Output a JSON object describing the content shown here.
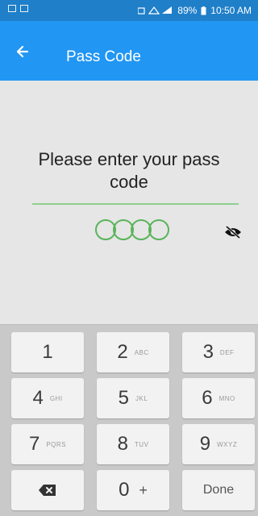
{
  "status_bar": {
    "battery": "89%",
    "time": "10:50 AM"
  },
  "toolbar": {
    "title": "Pass Code"
  },
  "content": {
    "prompt": "Please enter your pass code",
    "pin_length": 4
  },
  "keypad": {
    "keys": [
      {
        "digit": "1",
        "letters": ""
      },
      {
        "digit": "2",
        "letters": "ABC"
      },
      {
        "digit": "3",
        "letters": "DEF"
      },
      {
        "digit": "4",
        "letters": "GHI"
      },
      {
        "digit": "5",
        "letters": "JKL"
      },
      {
        "digit": "6",
        "letters": "MNO"
      },
      {
        "digit": "7",
        "letters": "PQRS"
      },
      {
        "digit": "8",
        "letters": "TUV"
      },
      {
        "digit": "9",
        "letters": "WXYZ"
      },
      {
        "digit": "0",
        "letters": "+"
      }
    ],
    "done_label": "Done"
  },
  "colors": {
    "status_bar": "#1f7fc9",
    "toolbar": "#2196f3",
    "pin_accent": "#5bb35b",
    "keypad_bg": "#c9c9c9"
  },
  "icons": {
    "back": "arrow-left-icon",
    "visibility": "eye-off-icon",
    "backspace": "backspace-icon"
  }
}
